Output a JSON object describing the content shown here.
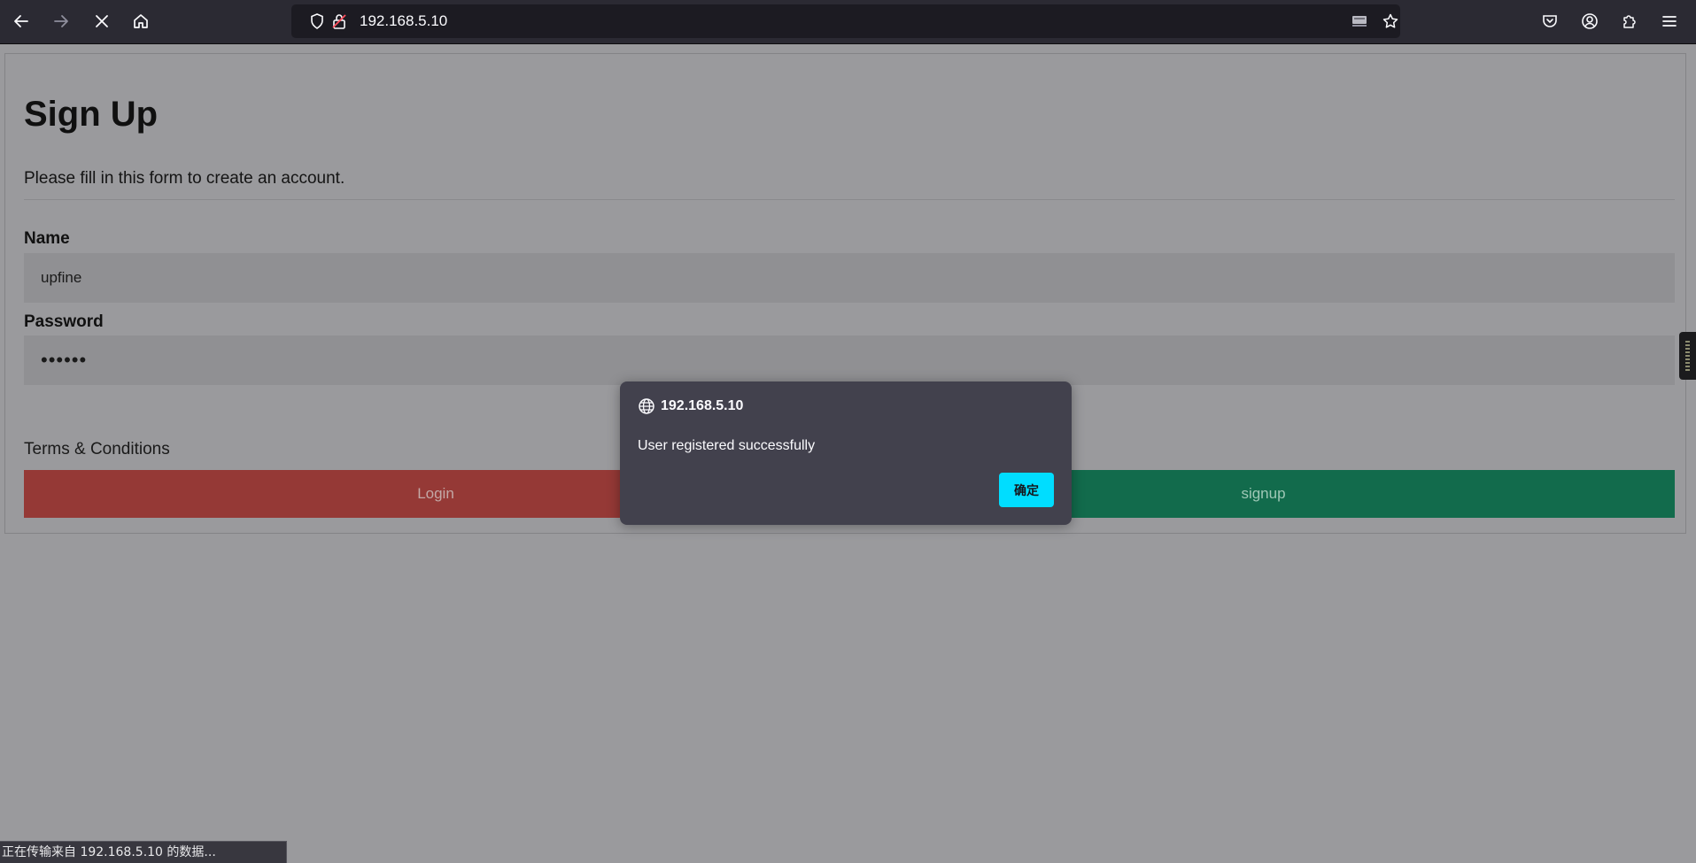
{
  "browser": {
    "url": "192.168.5.10",
    "icons": {
      "back": "arrow-left-icon",
      "forward": "arrow-right-icon",
      "stop": "close-icon",
      "home": "home-icon",
      "tracking": "shield-icon",
      "connection": "insecure-lock-icon",
      "reader": "reader-view-icon",
      "bookmark": "star-icon",
      "pocket": "pocket-icon",
      "account": "account-icon",
      "extensions": "puzzle-icon",
      "menu": "hamburger-menu-icon"
    }
  },
  "form": {
    "title": "Sign Up",
    "subtitle": "Please fill in this form to create an account.",
    "name_label": "Name",
    "name_value": "upfine",
    "password_label": "Password",
    "password_value": "••••••",
    "terms": "Terms & Conditions",
    "login_button": "Login",
    "signup_button": "signup"
  },
  "dialog": {
    "origin": "192.168.5.10",
    "message": "User registered successfully",
    "ok_button": "确定"
  },
  "status": {
    "text": "正在传输来自 192.168.5.10 的数据..."
  },
  "colors": {
    "toolbar": "#2b2a33",
    "dialog": "#42414d",
    "ok_button": "#00ddff",
    "login": "#953936",
    "signup": "#126b4c"
  }
}
